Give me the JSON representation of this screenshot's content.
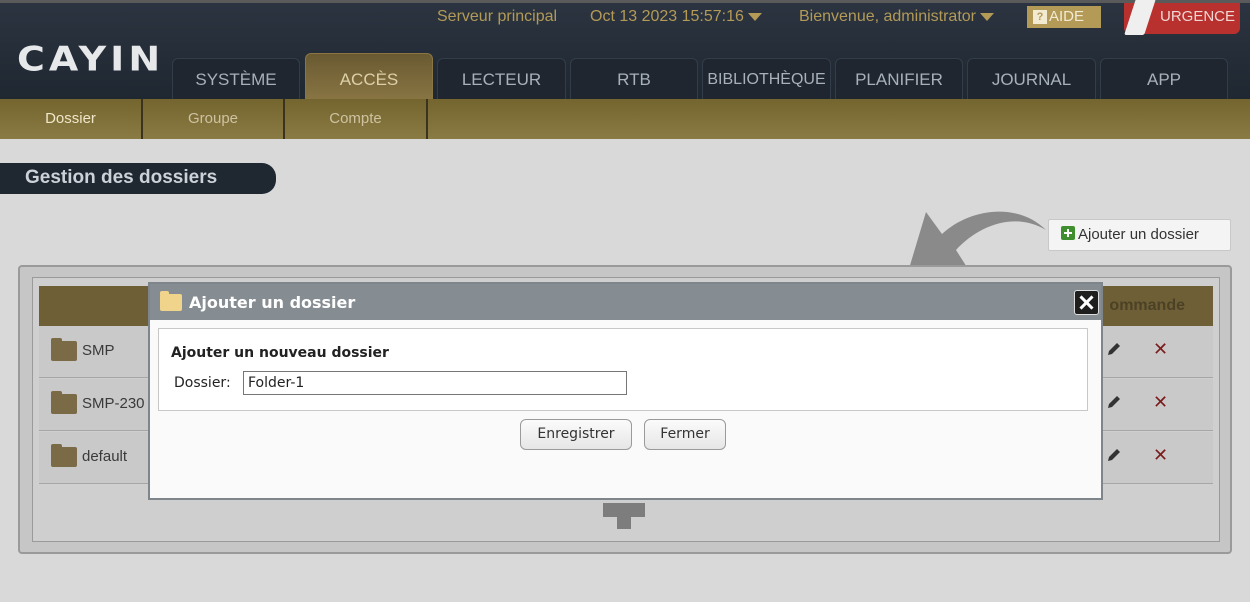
{
  "header": {
    "logo": "CAYIN",
    "server": "Serveur principal",
    "datetime": "Oct 13 2023 15:57:16",
    "welcome": "Bienvenue, administrator",
    "help": "AIDE",
    "urgent": "URGENCE"
  },
  "tabs": [
    {
      "label": "SYSTÈME"
    },
    {
      "label": "ACCÈS"
    },
    {
      "label": "LECTEUR"
    },
    {
      "label": "RTB"
    },
    {
      "label": "BIBLIOTHÈQUE"
    },
    {
      "label": "PLANIFIER"
    },
    {
      "label": "JOURNAL"
    },
    {
      "label": "APP"
    }
  ],
  "subnav": [
    {
      "label": "Dossier"
    },
    {
      "label": "Groupe"
    },
    {
      "label": "Compte"
    }
  ],
  "page": {
    "title": "Gestion des dossiers",
    "add_button": "Ajouter un dossier",
    "command_header": "ommande"
  },
  "rows": [
    {
      "name": "SMP"
    },
    {
      "name": "SMP-230"
    },
    {
      "name": "default"
    }
  ],
  "modal": {
    "title": "Ajouter un dossier",
    "heading": "Ajouter un nouveau dossier",
    "field_label": "Dossier:",
    "field_value": "Folder-1",
    "save": "Enregistrer",
    "close": "Fermer"
  },
  "colors": {
    "accent_gold": "#b39a57",
    "header_dark": "#1f2731",
    "urgent_red": "#b8312e"
  }
}
